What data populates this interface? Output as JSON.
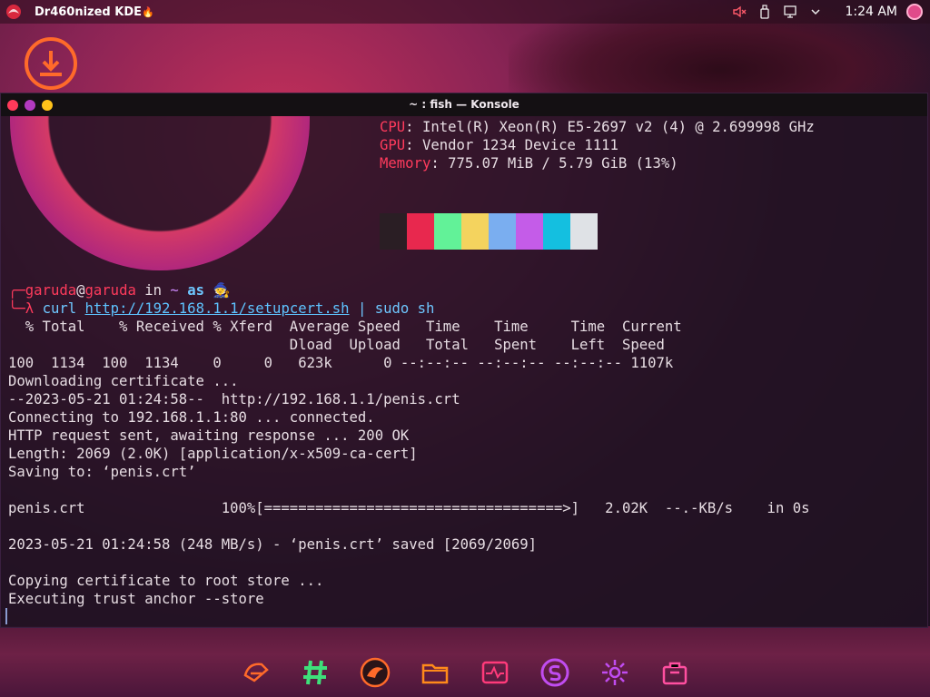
{
  "topbar": {
    "app_title": "Dr460nized KDE",
    "title_suffix": "🔥",
    "clock": "1:24 AM"
  },
  "window": {
    "title": "~ : fish — Konsole"
  },
  "sysinfo": {
    "cpu_label": "CPU",
    "cpu_value": ": Intel(R) Xeon(R) E5-2697 v2 (4) @ 2.699998 GHz",
    "gpu_label": "GPU",
    "gpu_value": ": Vendor 1234 Device 1111",
    "mem_label": "Memory",
    "mem_value": ": 775.07 MiB / 5.79 GiB (13%)",
    "palette": [
      "#2a1e24",
      "#e8284e",
      "#62f298",
      "#f4d35e",
      "#7aaef0",
      "#c45ce8",
      "#14bfe0",
      "#dfe2e6"
    ]
  },
  "prompt": {
    "user": "garuda",
    "at": "@",
    "host": "garuda",
    "in": " in ",
    "dir": "~",
    "as_word": " as ",
    "emoji": "🧙",
    "lambda": "λ",
    "cmd_curl": "curl",
    "cmd_url": "http://192.168.1.1/setupcert.sh",
    "cmd_pipe": " | sudo sh"
  },
  "curl_header": {
    "line1": "  % Total    % Received % Xferd  Average Speed   Time    Time     Time  Current",
    "line2": "                                 Dload  Upload   Total   Spent    Left  Speed",
    "line3": "100  1134  100  1134    0     0   623k      0 --:--:-- --:--:-- --:--:-- 1107k"
  },
  "output_lines": [
    "Downloading certificate ...",
    "--2023-05-21 01:24:58--  http://192.168.1.1/penis.crt",
    "Connecting to 192.168.1.1:80 ... connected.",
    "HTTP request sent, awaiting response ... 200 OK",
    "Length: 2069 (2.0K) [application/x-x509-ca-cert]",
    "Saving to: ‘penis.crt’",
    "",
    "penis.crt                100%[===================================>]   2.02K  --.-KB/s    in 0s",
    "",
    "2023-05-21 01:24:58 (248 MB/s) - ‘penis.crt’ saved [2069/2069]",
    "",
    "Copying certificate to root store ...",
    "Executing trust anchor --store"
  ],
  "dock": {
    "items": [
      "garuda-launcher-icon",
      "hashtag-icon",
      "dragon-icon",
      "folder-icon",
      "system-monitor-icon",
      "snapshot-icon",
      "settings-icon",
      "package-icon"
    ]
  },
  "colors": {
    "label_red": "#ff3b5c",
    "url_blue": "#5ec3ff",
    "accent_orange": "#ff7a2a",
    "accent_green": "#3ee07a",
    "accent_purple": "#c04cf0",
    "accent_pink": "#ff4fa0"
  }
}
